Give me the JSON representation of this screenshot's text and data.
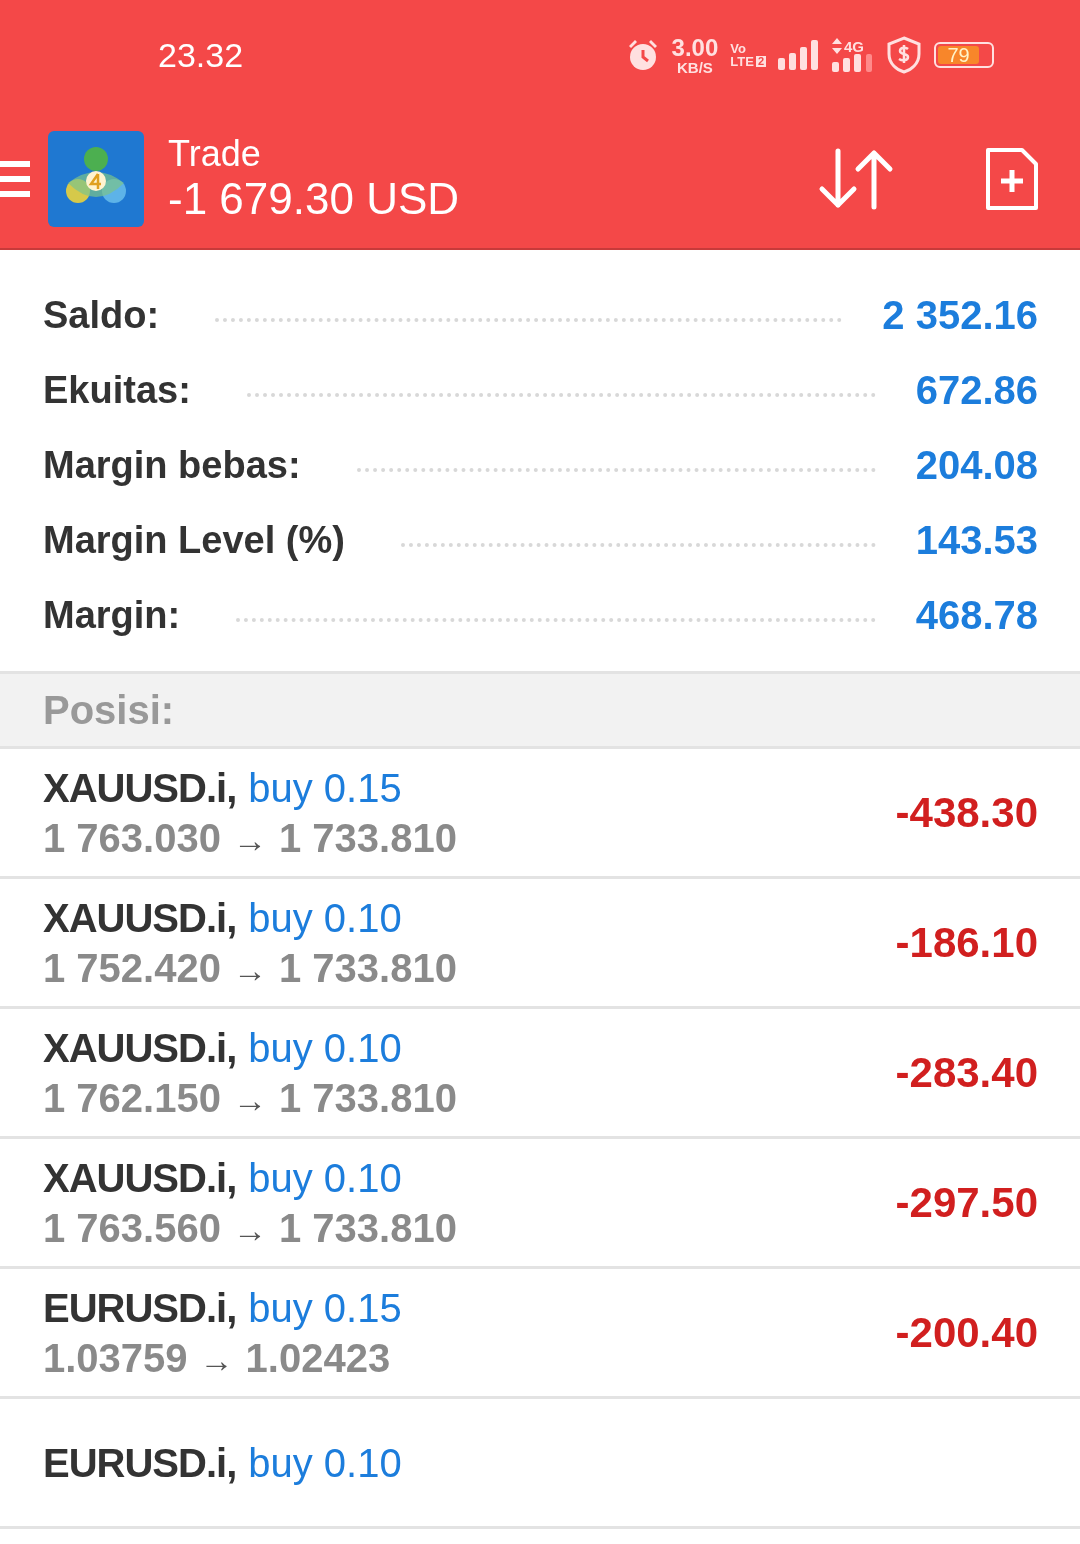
{
  "status_bar": {
    "time": "23.32",
    "speed": "3.00",
    "speed_unit": "KB/S",
    "volte": "Vo",
    "lte": "LTE",
    "sim": "2",
    "network": "4G",
    "battery": "79"
  },
  "header": {
    "title": "Trade",
    "balance": "-1 679.30 USD"
  },
  "summary": [
    {
      "label": "Saldo:",
      "value": "2 352.16"
    },
    {
      "label": "Ekuitas:",
      "value": "672.86"
    },
    {
      "label": "Margin bebas:",
      "value": "204.08"
    },
    {
      "label": "Margin Level (%)",
      "value": "143.53"
    },
    {
      "label": "Margin:",
      "value": "468.78"
    }
  ],
  "positions_header": "Posisi:",
  "positions": [
    {
      "symbol": "XAUUSD.i,",
      "type": "buy 0.15",
      "open": "1 763.030",
      "arrow": "→",
      "current": "1 733.810",
      "profit": "-438.30"
    },
    {
      "symbol": "XAUUSD.i,",
      "type": "buy 0.10",
      "open": "1 752.420",
      "arrow": "→",
      "current": "1 733.810",
      "profit": "-186.10"
    },
    {
      "symbol": "XAUUSD.i,",
      "type": "buy 0.10",
      "open": "1 762.150",
      "arrow": "→",
      "current": "1 733.810",
      "profit": "-283.40"
    },
    {
      "symbol": "XAUUSD.i,",
      "type": "buy 0.10",
      "open": "1 763.560",
      "arrow": "→",
      "current": "1 733.810",
      "profit": "-297.50"
    },
    {
      "symbol": "EURUSD.i,",
      "type": "buy 0.15",
      "open": "1.03759",
      "arrow": "→",
      "current": "1.02423",
      "profit": "-200.40"
    },
    {
      "symbol": "EURUSD.i,",
      "type": "buy 0.10"
    }
  ]
}
